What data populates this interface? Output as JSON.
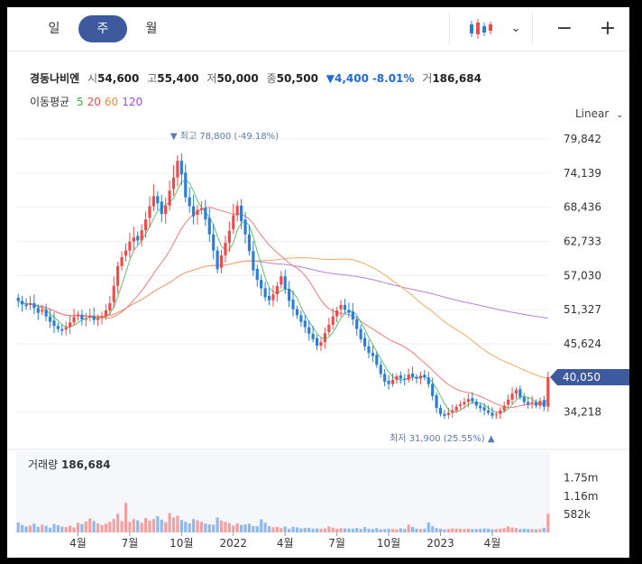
{
  "toolbar": {
    "periods": [
      "일",
      "주",
      "월"
    ],
    "active_period": "주"
  },
  "stock": {
    "name": "경동나비엔",
    "open_label": "시",
    "open": "54,600",
    "high_label": "고",
    "high": "55,400",
    "low_label": "저",
    "low": "50,000",
    "close_label": "종",
    "close": "50,500",
    "change": "4,400",
    "change_pct": "-8.01%",
    "volume_label": "거",
    "volume": "186,684"
  },
  "moving_average": {
    "label": "이동평균",
    "periods": [
      {
        "value": "5",
        "color": "#3cb04a"
      },
      {
        "value": "20",
        "color": "#f04b4b"
      },
      {
        "value": "60",
        "color": "#f08c28"
      },
      {
        "value": "120",
        "color": "#9a4fd6"
      }
    ]
  },
  "scale_label": "Linear",
  "chart_data": {
    "type": "candlestick",
    "price_axis": {
      "ticks": [
        "79,842",
        "74,139",
        "68,436",
        "62,733",
        "57,030",
        "51,327",
        "45,624",
        "34,218"
      ],
      "range": [
        31000,
        81500
      ],
      "current_price": "40,050"
    },
    "x_axis_labels": [
      "4월",
      "7월",
      "10월",
      "2022",
      "4월",
      "7월",
      "10월",
      "2023",
      "4월"
    ],
    "annotations": {
      "high": "최고 78,800 (-49.18%)",
      "low": "최저 31,900 (25.55%)"
    },
    "volume": {
      "label": "거래량",
      "value": "186,684",
      "ticks": [
        "1.75m",
        "1.16m",
        "582k"
      ]
    },
    "closes": [
      52800,
      52200,
      51900,
      52400,
      51600,
      50800,
      51300,
      50200,
      49300,
      48600,
      48100,
      47800,
      48400,
      49200,
      50100,
      50500,
      49700,
      49800,
      50300,
      49600,
      49900,
      50200,
      51200,
      52400,
      55300,
      58600,
      60100,
      61200,
      62700,
      63400,
      62900,
      64600,
      66400,
      68600,
      70300,
      69100,
      67300,
      68700,
      71200,
      73400,
      76200,
      73900,
      70100,
      68600,
      66900,
      68000,
      68300,
      66400,
      63900,
      61200,
      58100,
      60400,
      62500,
      64500,
      67100,
      68700,
      66100,
      63900,
      61100,
      57900,
      56300,
      54900,
      53400,
      52900,
      53900,
      55300,
      56900,
      54800,
      52800,
      51400,
      50400,
      49300,
      48400,
      47300,
      46400,
      45300,
      45900,
      47400,
      48800,
      50200,
      51200,
      52100,
      51300,
      50800,
      49700,
      48100,
      46400,
      45200,
      44100,
      43600,
      42100,
      40600,
      39300,
      38900,
      39600,
      40200,
      39800,
      39600,
      40500,
      40100,
      39800,
      40300,
      40000,
      38900,
      36900,
      34900,
      33900,
      33600,
      34100,
      34500,
      35100,
      35500,
      35900,
      36400,
      36000,
      35300,
      34900,
      34500,
      34100,
      33600,
      33900,
      34500,
      35300,
      36300,
      37300,
      37900,
      36700,
      35900,
      35500,
      35900,
      35300,
      36100,
      35100,
      40050
    ],
    "volumes": [
      0.32,
      0.24,
      0.19,
      0.22,
      0.28,
      0.18,
      0.25,
      0.21,
      0.15,
      0.27,
      0.23,
      0.19,
      0.17,
      0.22,
      0.16,
      0.31,
      0.27,
      0.35,
      0.45,
      0.37,
      0.29,
      0.24,
      0.28,
      0.34,
      0.43,
      0.6,
      0.36,
      0.95,
      0.34,
      0.43,
      0.39,
      0.31,
      0.46,
      0.38,
      0.43,
      0.52,
      0.41,
      0.33,
      0.62,
      0.48,
      0.54,
      0.4,
      0.34,
      0.29,
      0.43,
      0.39,
      0.34,
      0.28,
      0.26,
      0.25,
      0.48,
      0.38,
      0.34,
      0.3,
      0.22,
      0.29,
      0.24,
      0.26,
      0.28,
      0.21,
      0.2,
      0.42,
      0.31,
      0.2,
      0.17,
      0.18,
      0.14,
      0.19,
      0.12,
      0.18,
      0.16,
      0.13,
      0.14,
      0.15,
      0.12,
      0.13,
      0.12,
      0.13,
      0.19,
      0.15,
      0.12,
      0.14,
      0.13,
      0.13,
      0.12,
      0.14,
      0.11,
      0.17,
      0.12,
      0.11,
      0.14,
      0.1,
      0.11,
      0.12,
      0.11,
      0.1,
      0.13,
      0.11,
      0.25,
      0.18,
      0.12,
      0.11,
      0.12,
      0.32,
      0.2,
      0.14,
      0.12,
      0.1,
      0.11,
      0.13,
      0.12,
      0.12,
      0.11,
      0.12,
      0.11,
      0.11,
      0.12,
      0.13,
      0.12,
      0.1,
      0.11,
      0.12,
      0.14,
      0.2,
      0.16,
      0.14,
      0.11,
      0.12,
      0.11,
      0.11,
      0.1,
      0.11,
      0.15,
      0.6
    ],
    "colors": {
      "up": "#f04b4b",
      "down": "#2a7ed8",
      "current_price_tag": "#3d5a9e"
    }
  }
}
